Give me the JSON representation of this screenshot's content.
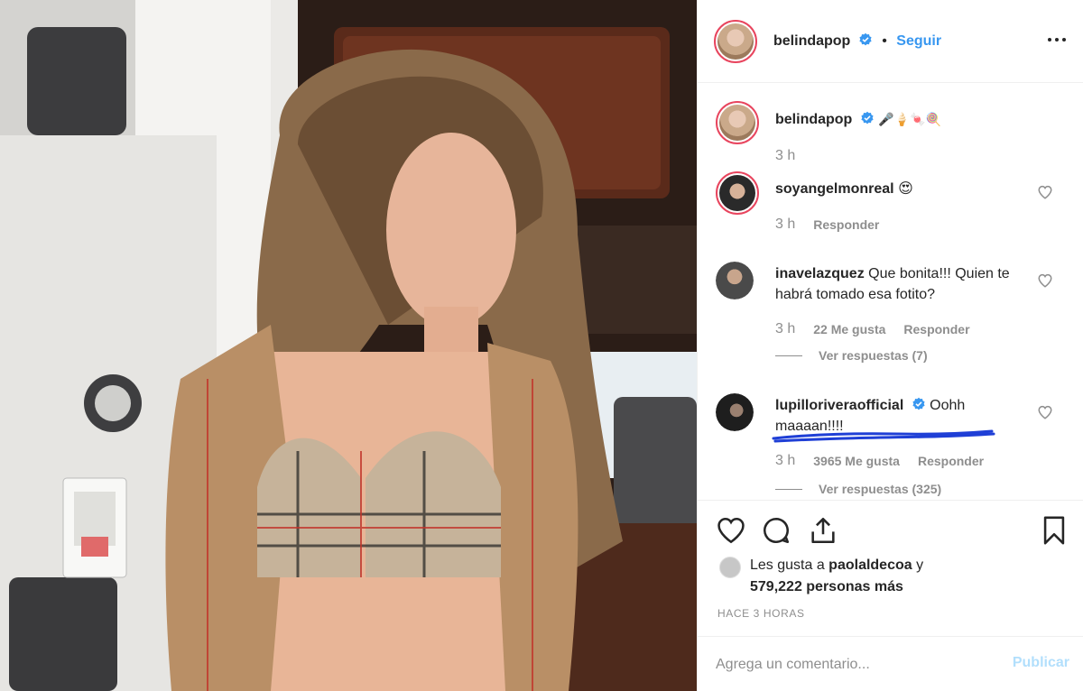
{
  "header": {
    "username": "belindapop",
    "separator": "•",
    "follow_label": "Seguir"
  },
  "caption": {
    "username": "belindapop",
    "text": "🎤🍦🍬🍭",
    "time": "3 h"
  },
  "comments": [
    {
      "username": "soyangelmonreal",
      "text": "😍",
      "time": "3 h",
      "likes": "",
      "reply_label": "Responder",
      "replies_label": ""
    },
    {
      "username": "inavelazquez",
      "text": "Que bonita!!! Quien te habrá tomado esa fotito?",
      "time": "3 h",
      "likes": "22 Me gusta",
      "reply_label": "Responder",
      "replies_label": "Ver respuestas (7)"
    },
    {
      "username": "lupilloriveraofficial",
      "text": "Oohh maaaan!!!!",
      "time": "3 h",
      "likes": "3965 Me gusta",
      "reply_label": "Responder",
      "replies_label": "Ver respuestas (325)"
    }
  ],
  "likes_line": {
    "prefix": "Les gusta a ",
    "user": "paolaldecoa",
    "suffix": " y",
    "count_text": "579,222 personas más"
  },
  "timestamp": "HACE 3 HORAS",
  "comment_input": {
    "placeholder": "Agrega un comentario...",
    "post_label": "Publicar"
  },
  "colors": {
    "link_blue": "#3897f0",
    "muted_gray": "#8e8e8e",
    "underline_scribble": "#1f3fd6"
  }
}
